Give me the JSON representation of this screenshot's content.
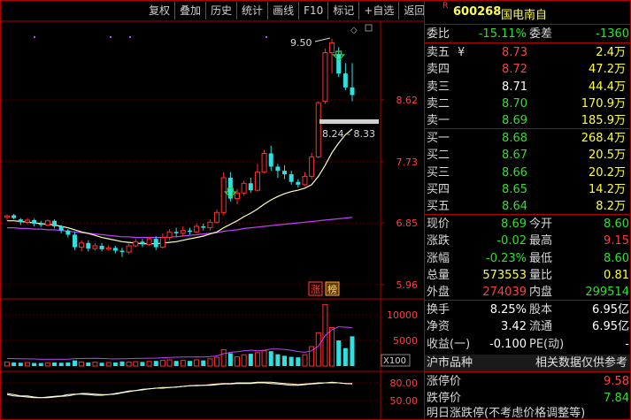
{
  "toolbar": [
    "复权",
    "叠加",
    "历史",
    "统计",
    "画线",
    "F10",
    "标记",
    "+自选",
    "返回"
  ],
  "stock": {
    "marker": "R",
    "code": "600268",
    "name": "国电南自"
  },
  "summary": {
    "weibi_label": "委比",
    "weibi": "-15.11%",
    "weicha_label": "委差",
    "weicha": "-1360"
  },
  "asks": [
    {
      "label": "卖五",
      "mark": "¥",
      "price": "8.73",
      "vol": "2.4",
      "unit": "万"
    },
    {
      "label": "卖四",
      "mark": "",
      "price": "8.72",
      "vol": "47.2",
      "unit": "万"
    },
    {
      "label": "卖三",
      "mark": "",
      "price": "8.71",
      "vol": "44.4",
      "unit": "万"
    },
    {
      "label": "卖二",
      "mark": "",
      "price": "8.70",
      "vol": "170.9",
      "unit": "万"
    },
    {
      "label": "卖一",
      "mark": "",
      "price": "8.69",
      "vol": "185.9",
      "unit": "万"
    }
  ],
  "bids": [
    {
      "label": "买一",
      "price": "8.68",
      "vol": "268.4",
      "unit": "万"
    },
    {
      "label": "买二",
      "price": "8.67",
      "vol": "20.5",
      "unit": "万"
    },
    {
      "label": "买三",
      "price": "8.66",
      "vol": "20.2",
      "unit": "万"
    },
    {
      "label": "买四",
      "price": "8.65",
      "vol": "14.2",
      "unit": "万"
    },
    {
      "label": "买五",
      "price": "8.64",
      "vol": "8.2",
      "unit": "万"
    }
  ],
  "stats": [
    {
      "l1": "现价",
      "v1": "8.69",
      "c1": "dn",
      "l2": "今开",
      "v2": "8.60",
      "c2": "dn"
    },
    {
      "l1": "涨跌",
      "v1": "-0.02",
      "c1": "dn",
      "l2": "最高",
      "v2": "9.15",
      "c2": "up"
    },
    {
      "l1": "涨幅",
      "v1": "-0.23%",
      "c1": "dn",
      "l2": "最低",
      "v2": "8.60",
      "c2": "dn"
    },
    {
      "l1": "总量",
      "v1": "573553",
      "c1": "yl",
      "l2": "量比",
      "v2": "0.81",
      "c2": "yl"
    },
    {
      "l1": "外盘",
      "v1": "274039",
      "c1": "up",
      "l2": "内盘",
      "v2": "299514",
      "c2": "dn"
    }
  ],
  "fundamentals": [
    {
      "l1": "换手",
      "v1": "8.25%",
      "l2": "股本",
      "v2": "6.95亿"
    },
    {
      "l1": "净资",
      "v1": "3.42",
      "l2": "流通",
      "v2": "6.95亿"
    },
    {
      "l1": "收益(一)",
      "v1": "-0.100",
      "l2": "PE(动)",
      "v2": "-"
    }
  ],
  "market": {
    "left": "沪市品种",
    "right": "相关数据仅供参考"
  },
  "limits": [
    {
      "label": "涨停价",
      "value": "9.58",
      "c": "up"
    },
    {
      "label": "跌停价",
      "value": "7.84",
      "c": "dn"
    }
  ],
  "footer_text": "明日涨跌停(不考虑价格调整等)",
  "chart_data": {
    "type": "candlestick",
    "price_ticks": [
      "8.62",
      "7.73",
      "6.85",
      "5.96"
    ],
    "price_tick_values": [
      8.62,
      7.73,
      6.85,
      5.96
    ],
    "volume_ticks": [
      "10000",
      "5000"
    ],
    "volume_unit": "X100",
    "osc_ticks": [
      "80.00",
      "50.00"
    ],
    "annotations": {
      "high_label": "9.50",
      "range_label": "8.24 - 8.33",
      "zt_label": "涨",
      "bang_label": "榜"
    },
    "colors": {
      "up": "#ff3030",
      "down": "#30e0e0",
      "ma_short": "#ffffc0",
      "ma_long": "#c040ff",
      "osc_a": "#ffffc0",
      "osc_b": "#ffffff"
    },
    "candles": [
      [
        6.93,
        6.95,
        6.88,
        6.97
      ],
      [
        6.96,
        6.92,
        6.9,
        6.98
      ],
      [
        6.9,
        6.86,
        6.82,
        6.92
      ],
      [
        6.86,
        6.89,
        6.83,
        6.92
      ],
      [
        6.89,
        6.84,
        6.8,
        6.91
      ],
      [
        6.84,
        6.82,
        6.79,
        6.88
      ],
      [
        6.82,
        6.88,
        6.8,
        6.9
      ],
      [
        6.88,
        6.8,
        6.77,
        6.9
      ],
      [
        6.8,
        6.74,
        6.7,
        6.82
      ],
      [
        6.74,
        6.68,
        6.64,
        6.76
      ],
      [
        6.68,
        6.5,
        6.46,
        6.72
      ],
      [
        6.5,
        6.56,
        6.44,
        6.6
      ],
      [
        6.56,
        6.48,
        6.44,
        6.6
      ],
      [
        6.48,
        6.52,
        6.45,
        6.56
      ],
      [
        6.52,
        6.47,
        6.44,
        6.56
      ],
      [
        6.47,
        6.49,
        6.45,
        6.53
      ],
      [
        6.49,
        6.45,
        6.41,
        6.52
      ],
      [
        6.45,
        6.43,
        6.36,
        6.49
      ],
      [
        6.43,
        6.52,
        6.4,
        6.55
      ],
      [
        6.52,
        6.58,
        6.5,
        6.62
      ],
      [
        6.58,
        6.54,
        6.5,
        6.62
      ],
      [
        6.54,
        6.62,
        6.52,
        6.65
      ],
      [
        6.62,
        6.5,
        6.46,
        6.66
      ],
      [
        6.5,
        6.64,
        6.48,
        6.7
      ],
      [
        6.64,
        6.72,
        6.6,
        6.76
      ],
      [
        6.72,
        6.7,
        6.65,
        6.78
      ],
      [
        6.7,
        6.74,
        6.66,
        6.8
      ],
      [
        6.74,
        6.72,
        6.68,
        6.78
      ],
      [
        6.72,
        6.8,
        6.7,
        6.84
      ],
      [
        6.8,
        6.78,
        6.74,
        6.84
      ],
      [
        6.78,
        6.86,
        6.74,
        6.9
      ],
      [
        6.86,
        7.0,
        6.84,
        7.04
      ],
      [
        7.0,
        7.5,
        6.96,
        7.58
      ],
      [
        7.5,
        7.2,
        7.16,
        7.58
      ],
      [
        7.2,
        7.28,
        7.12,
        7.34
      ],
      [
        7.28,
        7.42,
        7.24,
        7.46
      ],
      [
        7.42,
        7.32,
        7.28,
        7.5
      ],
      [
        7.32,
        7.58,
        7.3,
        7.7
      ],
      [
        7.58,
        7.85,
        7.56,
        7.9
      ],
      [
        7.85,
        7.66,
        7.6,
        7.96
      ],
      [
        7.66,
        7.6,
        7.5,
        7.7
      ],
      [
        7.6,
        7.55,
        7.48,
        7.68
      ],
      [
        7.55,
        7.44,
        7.4,
        7.6
      ],
      [
        7.44,
        7.4,
        7.36,
        7.48
      ],
      [
        7.4,
        7.52,
        7.38,
        7.58
      ],
      [
        7.52,
        7.8,
        7.48,
        7.86
      ],
      [
        7.8,
        8.58,
        7.78,
        8.6
      ],
      [
        8.6,
        9.3,
        8.56,
        9.36
      ],
      [
        9.3,
        9.44,
        9.0,
        9.5
      ],
      [
        9.28,
        9.0,
        8.95,
        9.38
      ],
      [
        9.0,
        8.8,
        8.76,
        9.15
      ],
      [
        8.8,
        8.69,
        8.6,
        9.15
      ]
    ],
    "ma_short": [
      6.88,
      6.88,
      6.87,
      6.86,
      6.85,
      6.84,
      6.83,
      6.82,
      6.8,
      6.78,
      6.75,
      6.72,
      6.7,
      6.67,
      6.64,
      6.62,
      6.6,
      6.58,
      6.57,
      6.56,
      6.55,
      6.55,
      6.55,
      6.56,
      6.57,
      6.58,
      6.6,
      6.62,
      6.64,
      6.66,
      6.69,
      6.72,
      6.78,
      6.83,
      6.88,
      6.94,
      6.99,
      7.05,
      7.12,
      7.18,
      7.23,
      7.27,
      7.3,
      7.32,
      7.35,
      7.4,
      7.52,
      7.68,
      7.86,
      8.0,
      8.12,
      8.2
    ],
    "ma_long": [
      6.78,
      6.78,
      6.77,
      6.77,
      6.76,
      6.76,
      6.75,
      6.75,
      6.74,
      6.73,
      6.72,
      6.71,
      6.7,
      6.69,
      6.68,
      6.67,
      6.66,
      6.65,
      6.65,
      6.64,
      6.64,
      6.64,
      6.64,
      6.64,
      6.65,
      6.65,
      6.66,
      6.67,
      6.68,
      6.69,
      6.7,
      6.71,
      6.73,
      6.74,
      6.75,
      6.77,
      6.78,
      6.79,
      6.8,
      6.81,
      6.82,
      6.83,
      6.84,
      6.85,
      6.86,
      6.87,
      6.88,
      6.89,
      6.9,
      6.91,
      6.92,
      6.93
    ],
    "volume": [
      800,
      700,
      650,
      700,
      600,
      600,
      650,
      700,
      650,
      700,
      1100,
      800,
      700,
      750,
      650,
      700,
      700,
      900,
      800,
      850,
      800,
      900,
      1000,
      1100,
      1200,
      1000,
      1100,
      1000,
      1200,
      1100,
      1400,
      1700,
      3200,
      2500,
      1800,
      2200,
      2400,
      2600,
      3000,
      2900,
      2300,
      2000,
      1800,
      1700,
      2200,
      3800,
      6500,
      12000,
      7500,
      5000,
      3500,
      5800
    ],
    "osc_a": [
      62,
      60,
      58,
      58,
      56,
      55,
      55,
      56,
      57,
      58,
      60,
      62,
      62,
      61,
      60,
      60,
      61,
      63,
      65,
      67,
      68,
      70,
      71,
      72,
      72,
      73,
      74,
      75,
      76,
      76,
      77,
      78,
      79,
      79,
      80,
      80,
      80,
      81,
      81,
      81,
      80,
      79,
      78,
      77,
      78,
      79,
      80,
      80,
      81,
      80,
      79,
      78
    ],
    "osc_b": [
      60,
      58,
      57,
      56,
      55,
      55,
      56,
      57,
      58,
      60,
      61,
      61,
      60,
      59,
      59,
      60,
      62,
      64,
      66,
      67,
      69,
      70,
      71,
      71,
      72,
      73,
      74,
      75,
      75,
      76,
      76,
      77,
      78,
      78,
      79,
      79,
      79,
      80,
      80,
      79,
      78,
      77,
      76,
      76,
      77,
      78,
      79,
      80,
      80,
      80,
      79,
      79
    ]
  }
}
